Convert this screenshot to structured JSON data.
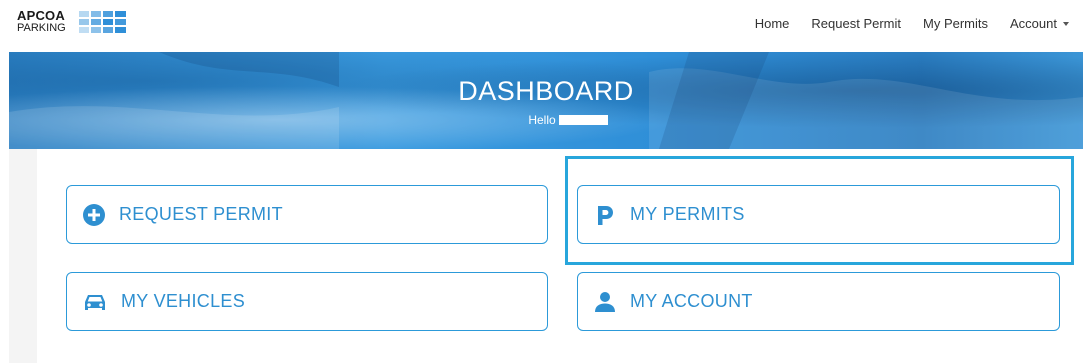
{
  "brand": {
    "line1": "APCOA",
    "line2": "PARKING",
    "grid_color": "#2f8fd8"
  },
  "nav": {
    "home": "Home",
    "request_permit": "Request Permit",
    "my_permits": "My Permits",
    "account": "Account"
  },
  "hero": {
    "title": "DASHBOARD",
    "greeting": "Hello"
  },
  "tiles": {
    "request_permit": {
      "label": "REQUEST PERMIT",
      "icon": "plus-circle-icon"
    },
    "my_permits": {
      "label": "MY PERMITS",
      "icon": "parking-p-icon"
    },
    "my_vehicles": {
      "label": "MY VEHICLES",
      "icon": "car-icon"
    },
    "my_account": {
      "label": "MY ACCOUNT",
      "icon": "user-icon"
    }
  },
  "colors": {
    "accent": "#2e8fd0",
    "highlight": "#28a6dc",
    "hero": "#3a9be0"
  }
}
